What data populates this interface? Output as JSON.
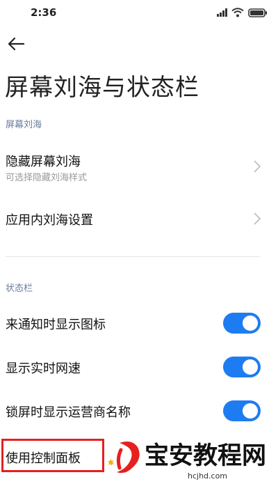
{
  "status_bar": {
    "time": "2:36"
  },
  "page": {
    "title": "屏幕刘海与状态栏"
  },
  "sections": {
    "notch": {
      "header": "屏幕刘海",
      "items": [
        {
          "title": "隐藏屏幕刘海",
          "subtitle": "可选择隐藏刘海样式"
        },
        {
          "title": "应用内刘海设置"
        }
      ]
    },
    "status_bar": {
      "header": "状态栏",
      "items": [
        {
          "title": "来通知时显示图标",
          "toggle_on": true
        },
        {
          "title": "显示实时网速",
          "toggle_on": true
        },
        {
          "title": "锁屏时显示运营商名称",
          "toggle_on": true
        },
        {
          "title": "使用控制面板"
        }
      ]
    }
  },
  "colors": {
    "accent": "#1e7cf2",
    "highlight": "#e5201f",
    "section_header": "#6a7b9c"
  },
  "watermark": {
    "text": "宝安教程网",
    "url": "hcjhd.com"
  }
}
